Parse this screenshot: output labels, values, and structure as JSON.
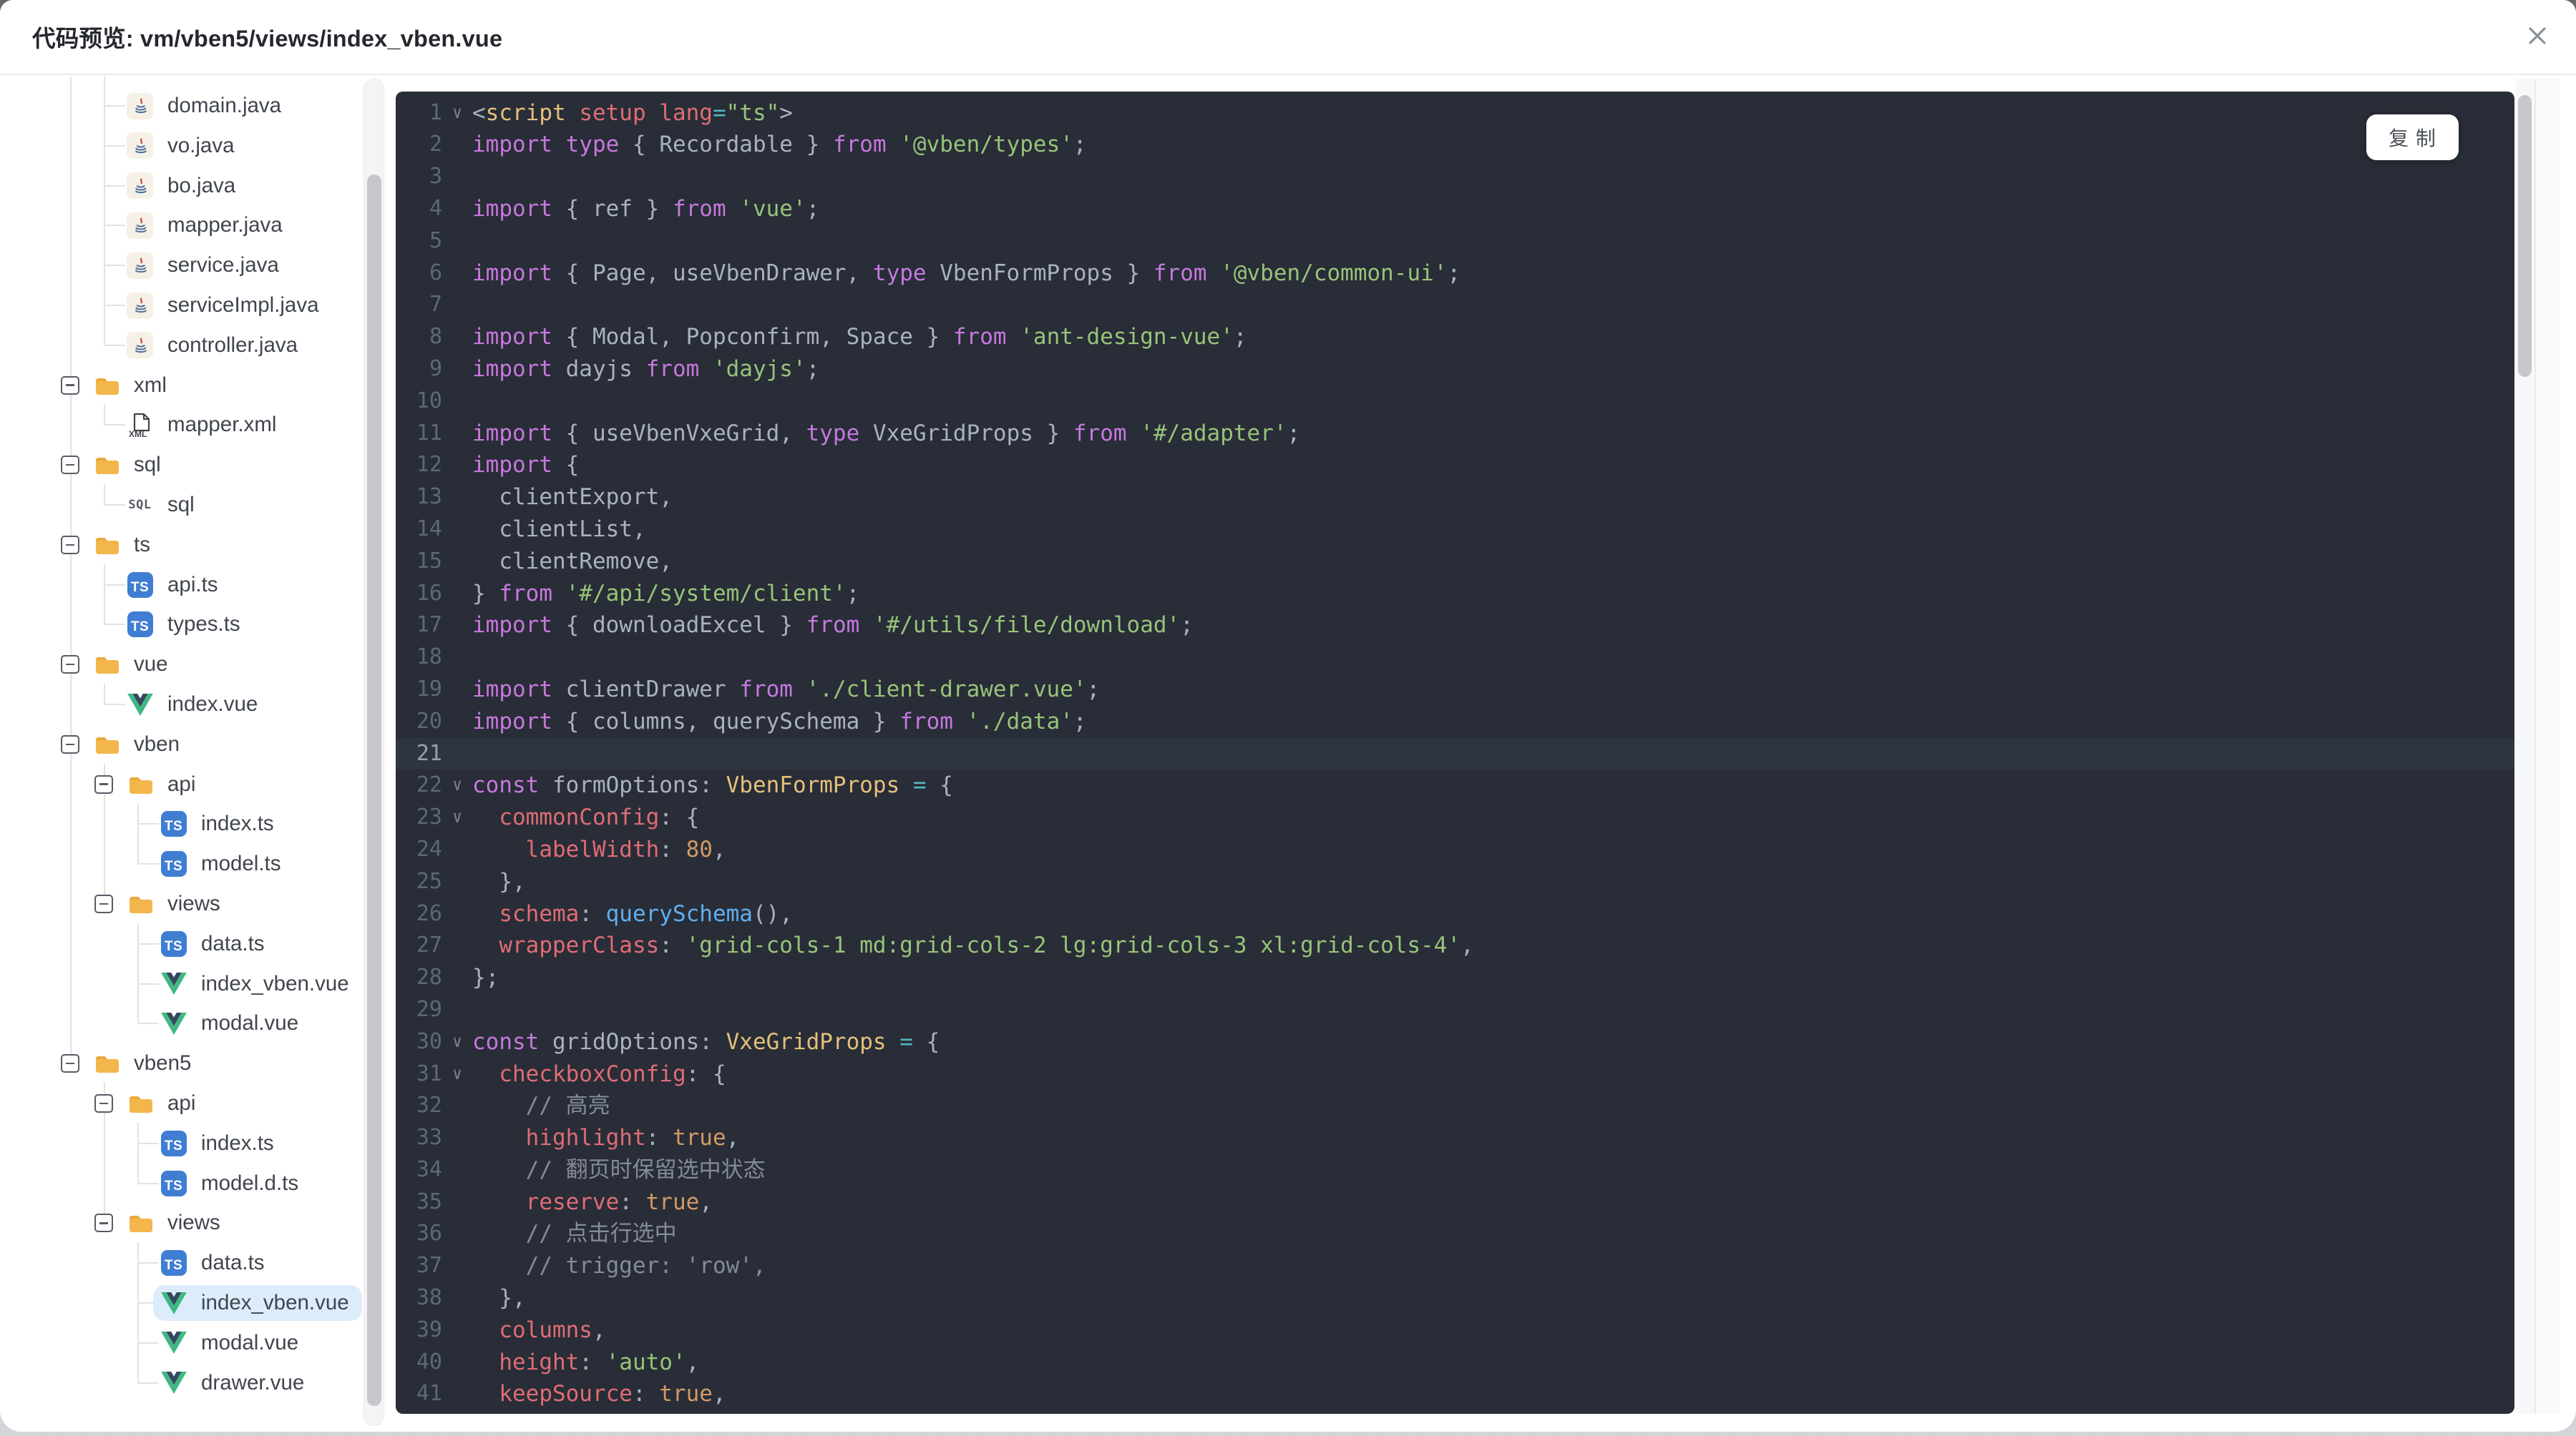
{
  "header": {
    "title": "代码预览: vm/vben5/views/index_vben.vue"
  },
  "icons": {
    "close": "✕",
    "fold_marker": "∨",
    "collapse_marker": "−"
  },
  "tree": {
    "root": [
      {
        "type": "group",
        "children": [
          {
            "label": "domain.java",
            "icon": "java"
          },
          {
            "label": "vo.java",
            "icon": "java"
          },
          {
            "label": "bo.java",
            "icon": "java"
          },
          {
            "label": "mapper.java",
            "icon": "java"
          },
          {
            "label": "service.java",
            "icon": "java"
          },
          {
            "label": "serviceImpl.java",
            "icon": "java"
          },
          {
            "label": "controller.java",
            "icon": "java"
          }
        ]
      },
      {
        "type": "folder",
        "label": "xml",
        "children": [
          {
            "label": "mapper.xml",
            "icon": "xml"
          }
        ]
      },
      {
        "type": "folder",
        "label": "sql",
        "children": [
          {
            "label": "sql",
            "icon": "sql"
          }
        ]
      },
      {
        "type": "folder",
        "label": "ts",
        "children": [
          {
            "label": "api.ts",
            "icon": "ts"
          },
          {
            "label": "types.ts",
            "icon": "ts"
          }
        ]
      },
      {
        "type": "folder",
        "label": "vue",
        "children": [
          {
            "label": "index.vue",
            "icon": "vue"
          }
        ]
      },
      {
        "type": "folder",
        "label": "vben",
        "children": [
          {
            "type": "folder",
            "label": "api",
            "children": [
              {
                "label": "index.ts",
                "icon": "ts"
              },
              {
                "label": "model.ts",
                "icon": "ts"
              }
            ]
          },
          {
            "type": "folder",
            "label": "views",
            "children": [
              {
                "label": "data.ts",
                "icon": "ts"
              },
              {
                "label": "index_vben.vue",
                "icon": "vue"
              },
              {
                "label": "modal.vue",
                "icon": "vue"
              }
            ]
          }
        ]
      },
      {
        "type": "folder",
        "label": "vben5",
        "children": [
          {
            "type": "folder",
            "label": "api",
            "children": [
              {
                "label": "index.ts",
                "icon": "ts"
              },
              {
                "label": "model.d.ts",
                "icon": "ts"
              }
            ]
          },
          {
            "type": "folder",
            "label": "views",
            "children": [
              {
                "label": "data.ts",
                "icon": "ts"
              },
              {
                "label": "index_vben.vue",
                "icon": "vue",
                "selected": true
              },
              {
                "label": "modal.vue",
                "icon": "vue"
              },
              {
                "label": "drawer.vue",
                "icon": "vue"
              }
            ]
          }
        ]
      }
    ]
  },
  "code": {
    "copy_label": "复 制",
    "lines": [
      {
        "fold": true,
        "t": [
          [
            "pun",
            "<"
          ],
          [
            "tag",
            "script"
          ],
          [
            "attr",
            " setup lang"
          ],
          [
            "op",
            "="
          ],
          [
            "str",
            "\"ts\""
          ],
          [
            "pun",
            ">"
          ]
        ]
      },
      {
        "t": [
          [
            "kw",
            "import type"
          ],
          [
            "pun",
            " { "
          ],
          [
            "pln",
            "Recordable"
          ],
          [
            "pun",
            " } "
          ],
          [
            "kw",
            "from"
          ],
          [
            "str",
            " '@vben/types'"
          ],
          [
            "pun",
            ";"
          ]
        ]
      },
      {
        "t": []
      },
      {
        "t": [
          [
            "kw",
            "import"
          ],
          [
            "pun",
            " { "
          ],
          [
            "pln",
            "ref"
          ],
          [
            "pun",
            " } "
          ],
          [
            "kw",
            "from"
          ],
          [
            "str",
            " 'vue'"
          ],
          [
            "pun",
            ";"
          ]
        ]
      },
      {
        "t": []
      },
      {
        "t": [
          [
            "kw",
            "import"
          ],
          [
            "pun",
            " { "
          ],
          [
            "pln",
            "Page, useVbenDrawer, "
          ],
          [
            "kw",
            "type"
          ],
          [
            "pln",
            " VbenFormProps"
          ],
          [
            "pun",
            " } "
          ],
          [
            "kw",
            "from"
          ],
          [
            "str",
            " '@vben/common-ui'"
          ],
          [
            "pun",
            ";"
          ]
        ]
      },
      {
        "t": []
      },
      {
        "t": [
          [
            "kw",
            "import"
          ],
          [
            "pun",
            " { "
          ],
          [
            "pln",
            "Modal, Popconfirm, Space"
          ],
          [
            "pun",
            " } "
          ],
          [
            "kw",
            "from"
          ],
          [
            "str",
            " 'ant-design-vue'"
          ],
          [
            "pun",
            ";"
          ]
        ]
      },
      {
        "t": [
          [
            "kw",
            "import"
          ],
          [
            "pln",
            " dayjs "
          ],
          [
            "kw",
            "from"
          ],
          [
            "str",
            " 'dayjs'"
          ],
          [
            "pun",
            ";"
          ]
        ]
      },
      {
        "t": []
      },
      {
        "t": [
          [
            "kw",
            "import"
          ],
          [
            "pun",
            " { "
          ],
          [
            "pln",
            "useVbenVxeGrid, "
          ],
          [
            "kw",
            "type"
          ],
          [
            "pln",
            " VxeGridProps"
          ],
          [
            "pun",
            " } "
          ],
          [
            "kw",
            "from"
          ],
          [
            "str",
            " '#/adapter'"
          ],
          [
            "pun",
            ";"
          ]
        ]
      },
      {
        "t": [
          [
            "kw",
            "import"
          ],
          [
            "pun",
            " {"
          ]
        ]
      },
      {
        "t": [
          [
            "pln",
            "  clientExport"
          ],
          [
            "pun",
            ","
          ]
        ]
      },
      {
        "t": [
          [
            "pln",
            "  clientList"
          ],
          [
            "pun",
            ","
          ]
        ]
      },
      {
        "t": [
          [
            "pln",
            "  clientRemove"
          ],
          [
            "pun",
            ","
          ]
        ]
      },
      {
        "t": [
          [
            "pun",
            "} "
          ],
          [
            "kw",
            "from"
          ],
          [
            "str",
            " '#/api/system/client'"
          ],
          [
            "pun",
            ";"
          ]
        ]
      },
      {
        "t": [
          [
            "kw",
            "import"
          ],
          [
            "pun",
            " { "
          ],
          [
            "pln",
            "downloadExcel"
          ],
          [
            "pun",
            " } "
          ],
          [
            "kw",
            "from"
          ],
          [
            "str",
            " '#/utils/file/download'"
          ],
          [
            "pun",
            ";"
          ]
        ]
      },
      {
        "t": []
      },
      {
        "t": [
          [
            "kw",
            "import"
          ],
          [
            "pln",
            " clientDrawer "
          ],
          [
            "kw",
            "from"
          ],
          [
            "str",
            " './client-drawer.vue'"
          ],
          [
            "pun",
            ";"
          ]
        ]
      },
      {
        "t": [
          [
            "kw",
            "import"
          ],
          [
            "pun",
            " { "
          ],
          [
            "pln",
            "columns, querySchema"
          ],
          [
            "pun",
            " } "
          ],
          [
            "kw",
            "from"
          ],
          [
            "str",
            " './data'"
          ],
          [
            "pun",
            ";"
          ]
        ]
      },
      {
        "hl": true,
        "t": []
      },
      {
        "fold": true,
        "t": [
          [
            "kw",
            "const"
          ],
          [
            "pln",
            " formOptions"
          ],
          [
            "pun",
            ": "
          ],
          [
            "type",
            "VbenFormProps"
          ],
          [
            "op",
            " = "
          ],
          [
            "pun",
            "{"
          ]
        ]
      },
      {
        "fold": true,
        "t": [
          [
            "prop",
            "  commonConfig"
          ],
          [
            "pun",
            ": {"
          ]
        ]
      },
      {
        "t": [
          [
            "prop",
            "    labelWidth"
          ],
          [
            "pun",
            ": "
          ],
          [
            "num",
            "80"
          ],
          [
            "pun",
            ","
          ]
        ]
      },
      {
        "t": [
          [
            "pun",
            "  },"
          ]
        ]
      },
      {
        "t": [
          [
            "prop",
            "  schema"
          ],
          [
            "pun",
            ": "
          ],
          [
            "fn",
            "querySchema"
          ],
          [
            "pun",
            "(),"
          ]
        ]
      },
      {
        "t": [
          [
            "prop",
            "  wrapperClass"
          ],
          [
            "pun",
            ": "
          ],
          [
            "str",
            "'grid-cols-1 md:grid-cols-2 lg:grid-cols-3 xl:grid-cols-4'"
          ],
          [
            "pun",
            ","
          ]
        ]
      },
      {
        "t": [
          [
            "pun",
            "};"
          ]
        ]
      },
      {
        "t": []
      },
      {
        "fold": true,
        "t": [
          [
            "kw",
            "const"
          ],
          [
            "pln",
            "​ gridOptions"
          ],
          [
            "pun",
            ": "
          ],
          [
            "type",
            "VxeGridProps"
          ],
          [
            "op",
            " = "
          ],
          [
            "pun",
            "{"
          ]
        ]
      },
      {
        "fold": true,
        "t": [
          [
            "prop",
            "  checkboxConfig"
          ],
          [
            "pun",
            ": {"
          ]
        ]
      },
      {
        "t": [
          [
            "com",
            "    // 高亮"
          ]
        ]
      },
      {
        "t": [
          [
            "prop",
            "    highlight"
          ],
          [
            "pun",
            ": "
          ],
          [
            "num",
            "true"
          ],
          [
            "pun",
            ","
          ]
        ]
      },
      {
        "t": [
          [
            "com",
            "    // 翻页时保留选中状态"
          ]
        ]
      },
      {
        "t": [
          [
            "prop",
            "    reserve"
          ],
          [
            "pun",
            ": "
          ],
          [
            "num",
            "true"
          ],
          [
            "pun",
            ","
          ]
        ]
      },
      {
        "t": [
          [
            "com",
            "    // 点击行选中"
          ]
        ]
      },
      {
        "t": [
          [
            "com",
            "    // trigger: 'row',"
          ]
        ]
      },
      {
        "t": [
          [
            "pun",
            "  },"
          ]
        ]
      },
      {
        "t": [
          [
            "prop",
            "  columns"
          ],
          [
            "pun",
            ","
          ]
        ]
      },
      {
        "t": [
          [
            "prop",
            "  height"
          ],
          [
            "pun",
            ": "
          ],
          [
            "str",
            "'auto'"
          ],
          [
            "pun",
            ","
          ]
        ]
      },
      {
        "t": [
          [
            "prop",
            "  keepSource"
          ],
          [
            "pun",
            ": "
          ],
          [
            "num",
            "true"
          ],
          [
            "pun",
            ","
          ]
        ]
      }
    ]
  },
  "colors": {
    "header-border": "#e8e9eb",
    "title": "#25282e",
    "close": "#8b9198",
    "tree-text": "#40454e",
    "guide": "#e0e2e6",
    "folder": "#f2b64b",
    "ts-blue": "#3f7ed2",
    "vue-green": "#41b883",
    "vue-dark": "#35495e",
    "selected-bg": "#dcecfb",
    "scroll-thumb": "#c6c7ca",
    "scroll-track": "#f4f4f6",
    "code-bg": "#282d37",
    "code-line-hl": "#2f3540",
    "gutter": "#5e6876",
    "kw": "#c678dd",
    "str": "#98c379",
    "prop": "#e06c75",
    "num": "#d19a66",
    "type": "#e5c07b",
    "fn": "#61afef",
    "op": "#56b6c2",
    "com": "#848b98",
    "pln": "#abb2bf",
    "pun": "#abb2bf",
    "btn-text": "#4a5058"
  }
}
